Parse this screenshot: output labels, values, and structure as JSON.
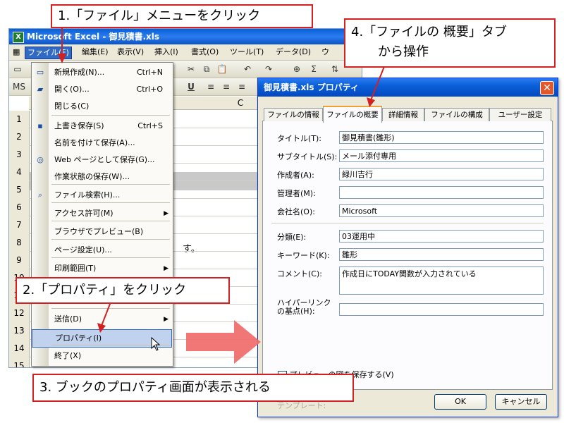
{
  "excel": {
    "title": "Microsoft Excel - 御見積書.xls",
    "menus": [
      "ファイル(F)",
      "編集(E)",
      "表示(V)",
      "挿入(I)",
      "書式(O)",
      "ツール(T)",
      "データ(D)",
      "ウ"
    ],
    "column_c": "C",
    "rows": [
      "1",
      "2",
      "3",
      "4",
      "5",
      "6",
      "7",
      "8",
      "9",
      "10",
      "11",
      "12",
      "13",
      "14",
      "15",
      "16"
    ],
    "cell_fragment": "す。",
    "cell_fragment_bottom": "名"
  },
  "file_menu": {
    "items": [
      {
        "label": "新規作成(N)...",
        "shortcut": "Ctrl+N",
        "icon": "new-document-icon"
      },
      {
        "label": "開く(O)...",
        "shortcut": "Ctrl+O",
        "icon": "open-folder-icon"
      },
      {
        "label": "閉じる(C)",
        "shortcut": "",
        "icon": ""
      },
      {
        "label": "上書き保存(S)",
        "shortcut": "Ctrl+S",
        "icon": "save-icon"
      },
      {
        "label": "名前を付けて保存(A)...",
        "shortcut": "",
        "icon": ""
      },
      {
        "label": "Web ページとして保存(G)...",
        "shortcut": "",
        "icon": "web-save-icon"
      },
      {
        "label": "作業状態の保存(W)...",
        "shortcut": "",
        "icon": ""
      },
      {
        "label": "ファイル検索(H)...",
        "shortcut": "",
        "icon": "file-search-icon"
      },
      {
        "label": "アクセス許可(M)",
        "shortcut": "",
        "icon": "",
        "submenu": true
      },
      {
        "label": "ブラウザでプレビュー(B)",
        "shortcut": "",
        "icon": ""
      },
      {
        "label": "ページ設定(U)...",
        "shortcut": "",
        "icon": ""
      },
      {
        "label": "印刷範囲(T)",
        "shortcut": "",
        "icon": "",
        "submenu": true
      },
      {
        "label": "送信(D)",
        "shortcut": "",
        "icon": "",
        "submenu": true
      },
      {
        "label": "プロパティ(I)",
        "shortcut": "",
        "icon": ""
      },
      {
        "label": "終了(X)",
        "shortcut": "",
        "icon": ""
      }
    ]
  },
  "dialog": {
    "title": "御見積書.xls プロパティ",
    "tabs": [
      "ファイルの情報",
      "ファイルの概要",
      "詳細情報",
      "ファイルの構成",
      "ユーザー設定"
    ],
    "active_tab": "ファイルの概要",
    "fields": [
      {
        "label": "タイトル(T):",
        "value": "御見積書(雛形)"
      },
      {
        "label": "サブタイトル(S):",
        "value": "メール添付専用"
      },
      {
        "label": "作成者(A):",
        "value": "緑川吉行"
      },
      {
        "label": "管理者(M):",
        "value": ""
      },
      {
        "label": "会社名(O):",
        "value": "Microsoft"
      },
      {
        "label": "分類(E):",
        "value": "03運用中"
      },
      {
        "label": "キーワード(K):",
        "value": "雛形"
      },
      {
        "label": "コメント(C):",
        "value": "作成日にTODAY関数が入力されている"
      },
      {
        "label": "ハイパーリンクの基点(H):",
        "value": ""
      }
    ],
    "template_label": "テンプレート:",
    "checkbox_label": "プレビューの図を保存する(V)",
    "ok": "OK",
    "cancel": "キャンセル"
  },
  "callouts": {
    "step1": "1.「ファイル」メニューをクリック",
    "step2": "2.「プロパティ」をクリック",
    "step3": "3. ブックのプロパティ画面が表示される",
    "step4_line1": "4.「ファイルの 概要」タブ",
    "step4_line2": "から操作"
  },
  "colors": {
    "callout_border": "#d42020",
    "arrow": "#f06a6a",
    "titlebar": "#0a5fd8",
    "menu_highlight": "#316ac5"
  }
}
